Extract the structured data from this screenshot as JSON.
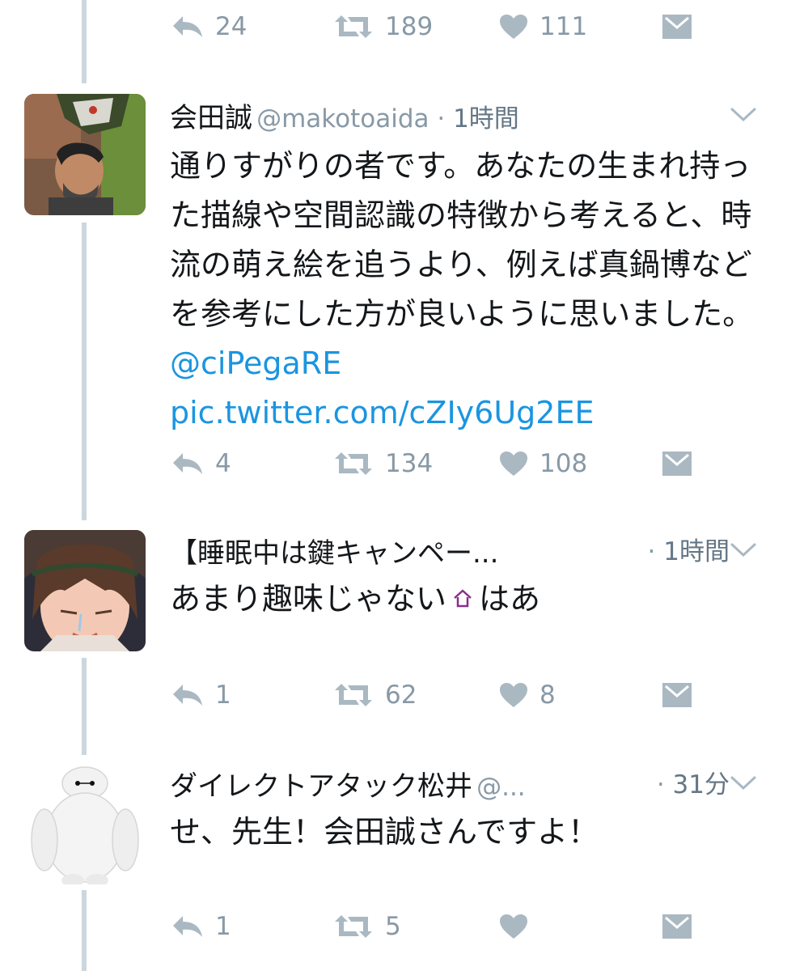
{
  "top_actions": {
    "reply": "24",
    "retweet": "189",
    "like": "111"
  },
  "tweets": [
    {
      "name": "会田誠",
      "handle": "@makotoaida",
      "sep": " · ",
      "time": "1時間",
      "text": "通りすがりの者です。あなたの生まれ持った描線や空間認識の特徴から考えると、時流の萌え絵を追うより、例えば真鍋博などを参考にした方が良いように思いました。",
      "mention": "@ciPegaRE",
      "pic_link": "pic.twitter.com/cZIy6Ug2EE",
      "reply": "4",
      "retweet": "134",
      "like": "108"
    },
    {
      "name": "【睡眠中は鍵キャンペー...",
      "sep": " · ",
      "time": "1時間",
      "text_before": "あまり趣味じゃない",
      "text_after": "はあ",
      "reply": "1",
      "retweet": "62",
      "like": "8"
    },
    {
      "name": "ダイレクトアタック松井",
      "handle": "@...",
      "sep": " · ",
      "time": "31分",
      "text": "せ、先生！会田誠さんですよ！",
      "reply": "1",
      "retweet": "5",
      "like": ""
    }
  ],
  "icons": [
    "reply-icon",
    "retweet-icon",
    "like-icon",
    "dm-icon",
    "caret-down-icon",
    "home-emoji-icon"
  ],
  "colors": {
    "link": "#1b95e0",
    "muted": "#8899a6",
    "icon": "#aab8c2",
    "thread": "#ccd6dd"
  }
}
